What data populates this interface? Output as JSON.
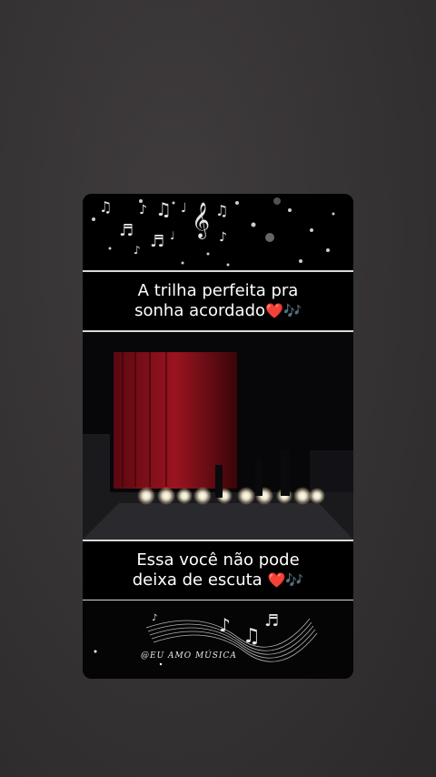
{
  "captions": {
    "top_line1": "A trilha perfeita pra",
    "top_line2": "sonha acordado",
    "top_emoji": "❤️🎶",
    "bottom_line1": "Essa você não pode",
    "bottom_line2": "deixa de escuta",
    "bottom_emoji": "❤️🎶"
  },
  "watermark": "@EU AMO MÚSICA",
  "icons": {
    "top_decoration": "music-notes-icon",
    "bottom_decoration": "music-wave-icon"
  },
  "colors": {
    "background": "#353233",
    "card": "#050505",
    "caption_text": "#ffffff",
    "curtain": "#8a0f18"
  }
}
